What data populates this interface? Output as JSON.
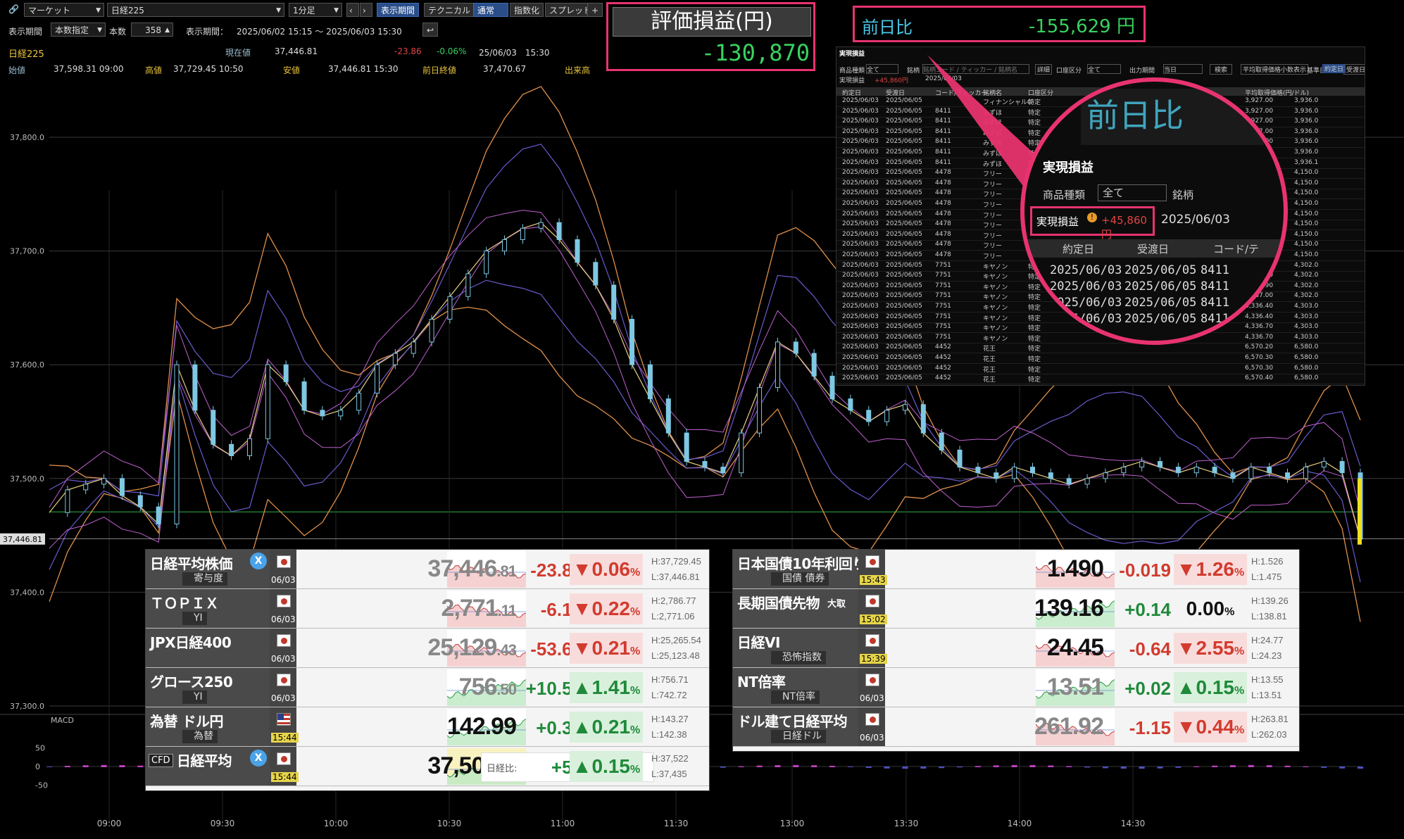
{
  "toolbar": {
    "market": "マーケット",
    "symbol": "日経225",
    "interval": "1分足",
    "btn_period": "表示期間",
    "btn_technical": "テクニカル",
    "btn_normal": "通常",
    "btn_index": "指数化",
    "btn_spread": "スプレッド",
    "btn_add": "+",
    "period_label": "表示期間",
    "period_mode": "本数指定",
    "count_label": "本数",
    "count_value": "358",
    "range_label": "表示期間：",
    "range_value": "2025/06/02 15:15 〜 2025/06/03 15:30"
  },
  "quote": {
    "name": "日経225",
    "current_label": "現在値",
    "current": "37,446.81",
    "change": "-23.86",
    "change_pct": "-0.06%",
    "timestamp": "25/06/03　15:30",
    "open_label": "始値",
    "open": "37,598.31 09:00",
    "high_label": "高値",
    "high": "37,729.45 10:50",
    "low_label": "安値",
    "low": "37,446.81 15:30",
    "prev_label": "前日終値",
    "prev": "37,470.67",
    "volume_label": "出来高"
  },
  "pnl": {
    "eval_label": "評価損益(円)",
    "eval_value": "-130,870",
    "daychange_label": "前日比",
    "daychange_value": "-155,629 円"
  },
  "realized": {
    "title": "実現損益",
    "filter_type_label": "商品種類",
    "filter_type": "全て",
    "filter_symbol_label": "銘柄",
    "filter_symbol_placeholder": "銘柄コード / ティッカー / 銘柄名",
    "btn_detail": "詳細",
    "account_label": "口座区分",
    "account": "全て",
    "output_label": "出力期間",
    "output": "当日",
    "btn_search": "検索",
    "btn_avg": "平均取得価格小数表示",
    "base_label": "基準日",
    "btn_contract": "約定日",
    "btn_settle": "受渡日",
    "sum_label": "実現損益",
    "sum_value": "+45,860円",
    "sum_date": "2025/06/03",
    "headers": [
      "約定日",
      "受渡日",
      "コード/ティッカー",
      "銘柄名",
      "口座区分",
      "平均取得価格(円/ドル)"
    ],
    "rows": [
      [
        "2025/06/03",
        "2025/06/05",
        "",
        "フィナンシャルG",
        "特定",
        "3,927.00",
        "3,936.0"
      ],
      [
        "2025/06/03",
        "2025/06/05",
        "8411",
        "みずほ",
        "特定",
        "3,927.00",
        "3,936.0"
      ],
      [
        "2025/06/03",
        "2025/06/05",
        "8411",
        "みずほ",
        "特定",
        "3,927.00",
        "3,936.0"
      ],
      [
        "2025/06/03",
        "2025/06/05",
        "8411",
        "みずほ",
        "特定",
        "3,927.00",
        "3,936.0"
      ],
      [
        "2025/06/03",
        "2025/06/05",
        "8411",
        "みずほ",
        "特定",
        "3,927.00",
        "3,936.0"
      ],
      [
        "2025/06/03",
        "2025/06/05",
        "8411",
        "みずほ",
        "特定",
        "3,927.00",
        "3,936.0"
      ],
      [
        "2025/06/03",
        "2025/06/05",
        "8411",
        "みずほ",
        "特定",
        "3,927.00",
        "3,936.1"
      ],
      [
        "2025/06/03",
        "2025/06/05",
        "4478",
        "フリー",
        "特定",
        "4,048.00",
        "4,150.0"
      ],
      [
        "2025/06/03",
        "2025/06/05",
        "4478",
        "フリー",
        "特定",
        "4,049.00",
        "4,150.0"
      ],
      [
        "2025/06/03",
        "2025/06/05",
        "4478",
        "フリー",
        "特定",
        "4,049.00",
        "4,150.0"
      ],
      [
        "2025/06/03",
        "2025/06/05",
        "4478",
        "フリー",
        "特定",
        "4,049.00",
        "4,150.0"
      ],
      [
        "2025/06/03",
        "2025/06/05",
        "4478",
        "フリー",
        "特定",
        "4,049.00",
        "4,150.0"
      ],
      [
        "2025/06/03",
        "2025/06/05",
        "4478",
        "フリー",
        "特定",
        "4,049.00",
        "4,150.0"
      ],
      [
        "2025/06/03",
        "2025/06/05",
        "4478",
        "フリー",
        "特定",
        "4,049.50",
        "4,150.0"
      ],
      [
        "2025/06/03",
        "2025/06/05",
        "4478",
        "フリー",
        "特定",
        "4,049.00",
        "4,150.0"
      ],
      [
        "2025/06/03",
        "2025/06/05",
        "4478",
        "フリー",
        "特定",
        "4,049.00",
        "4,150.0"
      ],
      [
        "2025/06/03",
        "2025/06/05",
        "7751",
        "キヤノン",
        "特定",
        "4,336.80",
        "4,302.0"
      ],
      [
        "2025/06/03",
        "2025/06/05",
        "7751",
        "キヤノン",
        "特定",
        "4,336.80",
        "4,302.0"
      ],
      [
        "2025/06/03",
        "2025/06/05",
        "7751",
        "キヤノン",
        "特定",
        "4,336.90",
        "4,302.0"
      ],
      [
        "2025/06/03",
        "2025/06/05",
        "7751",
        "キヤノン",
        "特定",
        "4,337.00",
        "4,302.0"
      ],
      [
        "2025/06/03",
        "2025/06/05",
        "7751",
        "キヤノン",
        "特定",
        "4,336.40",
        "4,303.0"
      ],
      [
        "2025/06/03",
        "2025/06/05",
        "7751",
        "キヤノン",
        "特定",
        "4,336.40",
        "4,303.0"
      ],
      [
        "2025/06/03",
        "2025/06/05",
        "7751",
        "キヤノン",
        "特定",
        "4,336.70",
        "4,303.0"
      ],
      [
        "2025/06/03",
        "2025/06/05",
        "7751",
        "キヤノン",
        "特定",
        "4,336.70",
        "4,303.0"
      ],
      [
        "2025/06/03",
        "2025/06/05",
        "4452",
        "花王",
        "特定",
        "6,570.20",
        "6,580.0"
      ],
      [
        "2025/06/03",
        "2025/06/05",
        "4452",
        "花王",
        "特定",
        "6,570.30",
        "6,580.0"
      ],
      [
        "2025/06/03",
        "2025/06/05",
        "4452",
        "花王",
        "特定",
        "6,570.30",
        "6,580.0"
      ],
      [
        "2025/06/03",
        "2025/06/05",
        "4452",
        "花王",
        "特定",
        "6,570.40",
        "6,580.0"
      ]
    ],
    "zoom_rows": [
      [
        "2025/06/03",
        "2025/06/05",
        "8411"
      ],
      [
        "2025/06/03",
        "2025/06/05",
        "8411"
      ],
      [
        "2025/06/03",
        "2025/06/05",
        "8411"
      ],
      [
        "2025/06/03",
        "2025/06/05",
        "8411"
      ]
    ],
    "zoom_headers": [
      "約定日",
      "受渡日",
      "コード/テ"
    ]
  },
  "chart_data": {
    "type": "line",
    "title": "日経225",
    "ylim": [
      37270,
      37860
    ],
    "yticks": [
      "37,800.0",
      "37,700.0",
      "37,600.0",
      "37,500.0",
      "37,400.0",
      "37,300.0"
    ],
    "yvalues": [
      37800,
      37700,
      37600,
      37500,
      37400,
      37300
    ],
    "last_label": "37,446.81",
    "xticks": [
      "09:00",
      "09:30",
      "10:00",
      "10:30",
      "11:00",
      "11:30",
      "13:00",
      "13:30",
      "14:00",
      "14:30"
    ],
    "close": [
      37470,
      37490,
      37495,
      37500,
      37485,
      37475,
      37460,
      37600,
      37560,
      37530,
      37520,
      37535,
      37600,
      37585,
      37560,
      37555,
      37560,
      37575,
      37600,
      37610,
      37620,
      37640,
      37660,
      37680,
      37700,
      37710,
      37720,
      37725,
      37710,
      37690,
      37670,
      37640,
      37600,
      37570,
      37540,
      37515,
      37510,
      37505,
      37540,
      37580,
      37620,
      37610,
      37590,
      37570,
      37560,
      37550,
      37560,
      37565,
      37540,
      37525,
      37510,
      37505,
      37500,
      37510,
      37505,
      37500,
      37495,
      37500,
      37505,
      37510,
      37515,
      37510,
      37505,
      37510,
      37505,
      37500,
      37510,
      37505,
      37500,
      37510,
      37515,
      37505,
      37446.81
    ],
    "macd_label": "MACD",
    "macd_ticks": [
      "50",
      "0",
      "-50"
    ],
    "macd_values": [
      50,
      0,
      -50
    ]
  },
  "tickers_left": [
    {
      "name": "日経平均株価",
      "sub": "寄与度",
      "date": "06/03",
      "price": "37,446",
      "price_dec": ".81",
      "change": "-23.86",
      "pct": "▼0.06",
      "pct_unit": "%",
      "high": "H:37,729.45",
      "low": "L:37,446.81",
      "dir": "down",
      "badge": "x"
    },
    {
      "name": "ＴＯＰＩＸ",
      "sub": "YI",
      "date": "06/03",
      "price": "2,771",
      "price_dec": ".11",
      "change": "-6.18",
      "pct": "▼0.22",
      "pct_unit": "%",
      "high": "H:2,786.77",
      "low": "L:2,771.06",
      "dir": "down"
    },
    {
      "name": "JPX日経400",
      "sub": "",
      "date": "06/03",
      "price": "25,129",
      "price_dec": ".43",
      "change": "-53.63",
      "pct": "▼0.21",
      "pct_unit": "%",
      "high": "H:25,265.54",
      "low": "L:25,123.48",
      "dir": "down"
    },
    {
      "name": "グロース250",
      "sub": "YI",
      "date": "06/03",
      "price": "756",
      "price_dec": ".50",
      "change": "+10.50",
      "pct": "▲1.41",
      "pct_unit": "%",
      "high": "H:756.71",
      "low": "L:742.72",
      "dir": "up"
    },
    {
      "name": "為替 ドル円",
      "sub": "為替",
      "date": "15:44",
      "price": "142.99",
      "price_dec": "",
      "change": "+0.30",
      "pct": "▲0.21",
      "pct_unit": "%",
      "high": "H:143.27",
      "low": "L:142.38",
      "dir": "up",
      "flag": "us"
    },
    {
      "name": "日経平均",
      "sub": "",
      "date": "15:44",
      "price": "37,503",
      "price_dec": ".00",
      "change": "+56",
      "pct": "▲0.15",
      "pct_unit": "%",
      "high": "H:37,522",
      "low": "L:37,435",
      "dir": "up",
      "badge": "x",
      "cfd": "CFD",
      "diff_label": "日経比:"
    }
  ],
  "tickers_right": [
    {
      "name": "日本国債10年利回り",
      "sub": "国債 債券",
      "date": "15:43",
      "price": "1.490",
      "change": "-0.019",
      "pct": "▼1.26",
      "pct_unit": "%",
      "high": "H:1.526",
      "low": "L:1.475",
      "dir": "down"
    },
    {
      "name": "長期国債先物",
      "name_suffix": "大取",
      "sub": "",
      "date": "15:02",
      "price": "139.16",
      "change": "+0.14",
      "pct": "0.00",
      "pct_unit": "%",
      "high": "H:139.26",
      "low": "L:138.81",
      "dir": "up"
    },
    {
      "name": "日経VI",
      "sub": "恐怖指数",
      "date": "15:39",
      "price": "24.45",
      "change": "-0.64",
      "pct": "▼2.55",
      "pct_unit": "%",
      "high": "H:24.77",
      "low": "L:24.23",
      "dir": "down"
    },
    {
      "name": "NT倍率",
      "sub": "NT倍率",
      "date": "06/03",
      "price": "13.51",
      "change": "+0.02",
      "pct": "▲0.15",
      "pct_unit": "%",
      "high": "H:13.55",
      "low": "L:13.51",
      "dir": "up"
    },
    {
      "name": "ドル建て日経平均",
      "sub": "日経ドル",
      "date": "06/03",
      "price": "261.92",
      "change": "-1.15",
      "pct": "▼0.44",
      "pct_unit": "%",
      "high": "H:263.81",
      "low": "L:262.03",
      "dir": "down"
    }
  ],
  "colors": {
    "up": "#1f8a3a",
    "down": "#d23b2e",
    "callout": "#e8336f",
    "candle": "#7ec8e3"
  }
}
